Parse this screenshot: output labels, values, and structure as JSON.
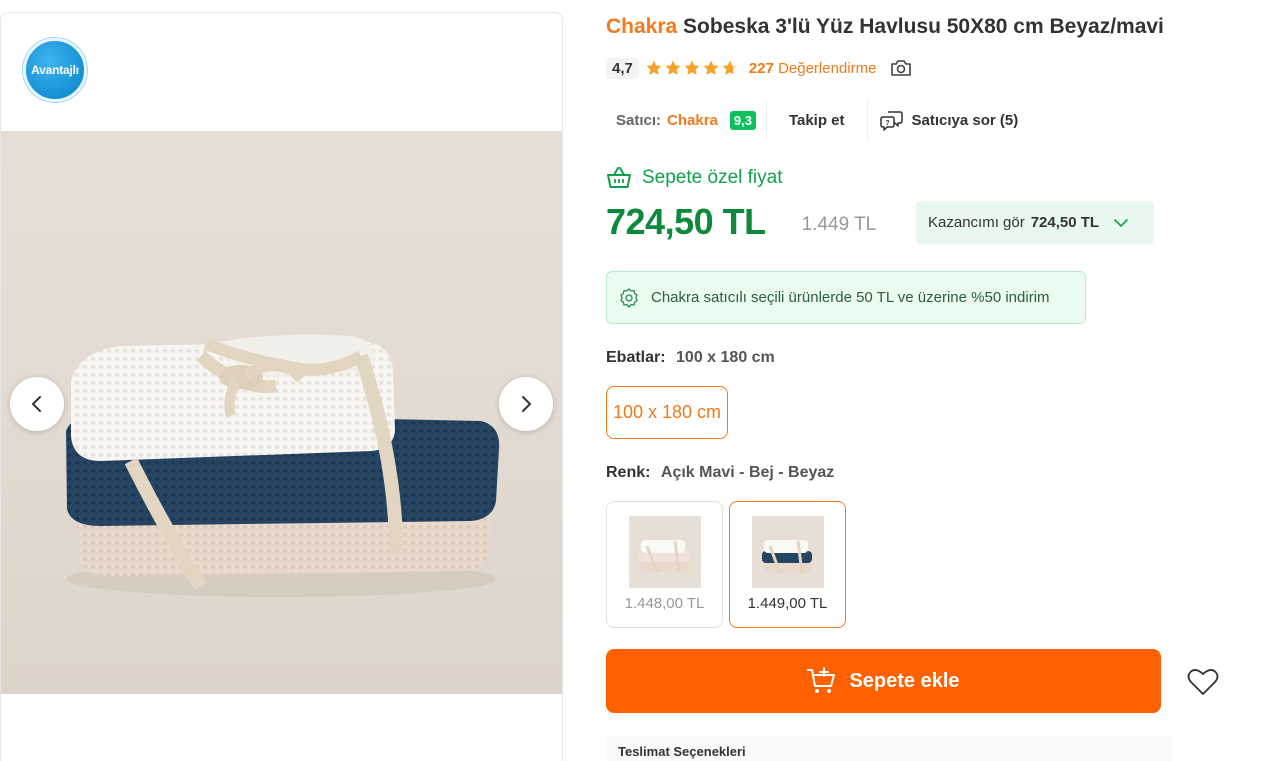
{
  "gallery": {
    "badge_label": "Avantajlı"
  },
  "product": {
    "brand": "Chakra",
    "title": "Sobeska 3'lü Yüz Havlusu 50X80 cm Beyaz/mavi"
  },
  "rating": {
    "score": "4,7",
    "stars": 4.7,
    "review_count": "227",
    "review_label": "Değerlendirme"
  },
  "seller": {
    "label": "Satıcı:",
    "name": "Chakra",
    "score": "9,3",
    "follow_label": "Takip et",
    "ask_label": "Satıcıya sor (5)"
  },
  "pricing": {
    "special_label": "Sepete özel fiyat",
    "price": "724,50 TL",
    "old_price": "1.449 TL",
    "earn_label": "Kazancımı gör",
    "earn_value": "724,50 TL"
  },
  "promo": {
    "text": "Chakra satıcılı seçili ürünlerde 50 TL ve üzerine %50 indirim"
  },
  "size": {
    "label": "Ebatlar:",
    "selected": "100 x 180 cm",
    "options": [
      "100 x 180 cm"
    ]
  },
  "color": {
    "label": "Renk:",
    "selected": "Açık Mavi - Bej - Beyaz",
    "variants": [
      {
        "price": "1.448,00 TL"
      },
      {
        "price": "1.449,00 TL"
      }
    ]
  },
  "actions": {
    "add_to_cart": "Sepete ekle"
  },
  "delivery": {
    "title": "Teslimat Seçenekleri"
  },
  "colors": {
    "accent": "#f27a1a",
    "cart": "#ff6000",
    "price_green": "#0a8a3a",
    "score_green": "#0bc15c"
  }
}
